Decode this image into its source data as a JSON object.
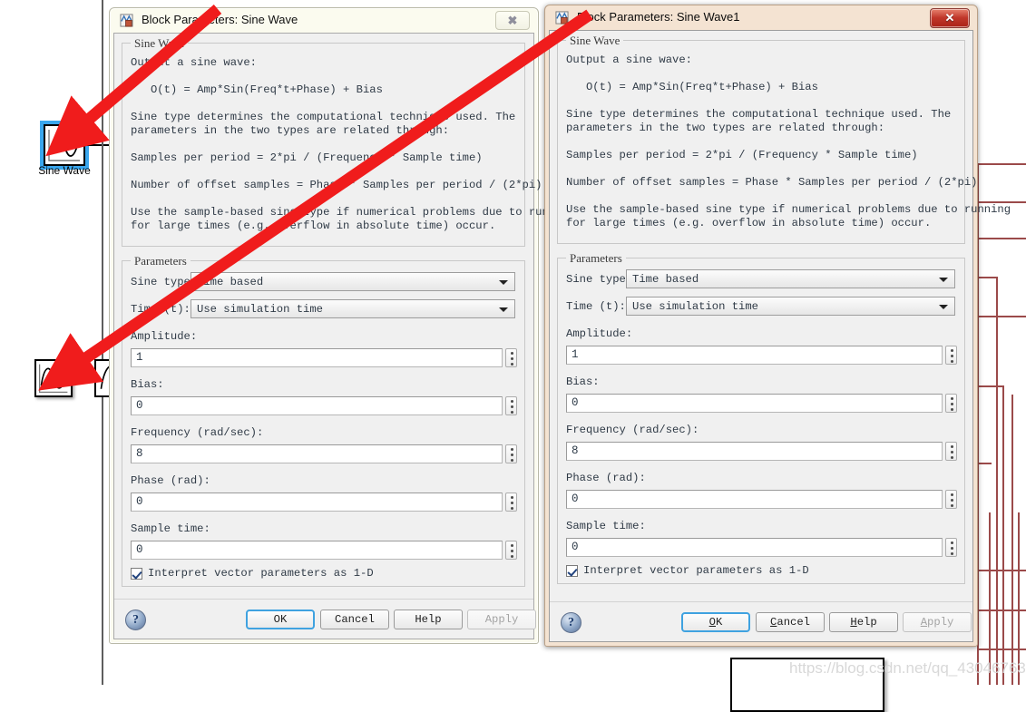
{
  "canvas": {
    "blocks": [
      {
        "name": "sine-wave-block-top",
        "label": "Sine Wave",
        "selected": true
      },
      {
        "name": "sine-wave-block-bottom",
        "label": "",
        "selected": false
      },
      {
        "name": "downstream-block",
        "label": "",
        "selected": false
      }
    ],
    "watermark": "https://blog.csdn.net/qq_43046763"
  },
  "dialogs": [
    {
      "id": "left",
      "active": false,
      "title": "Block Parameters: Sine Wave",
      "title_icon": "simulink-block-icon",
      "close_glyph": "✖",
      "description_group_title": "Sine Wave",
      "description_lines": [
        "Output a sine wave:",
        "",
        "   O(t) = Amp*Sin(Freq*t+Phase) + Bias",
        "",
        "Sine type determines the computational technique used. The",
        "parameters in the two types are related through:",
        "",
        "Samples per period = 2*pi / (Frequency * Sample time)",
        "",
        "Number of offset samples = Phase * Samples per period / (2*pi)",
        "",
        "Use the sample-based sine type if numerical problems due to running",
        "for large times (e.g. overflow in absolute time) occur."
      ],
      "parameters_group_title": "Parameters",
      "fields": [
        {
          "name": "sine-type",
          "label": "Sine type:",
          "type": "combo",
          "value": "Time based"
        },
        {
          "name": "time-t",
          "label": "Time (t):",
          "type": "combo",
          "value": "Use simulation time"
        },
        {
          "name": "amplitude",
          "label": "Amplitude:",
          "type": "edit",
          "value": "1"
        },
        {
          "name": "bias",
          "label": "Bias:",
          "type": "edit",
          "value": "0"
        },
        {
          "name": "frequency",
          "label": "Frequency (rad/sec):",
          "type": "edit",
          "value": "8"
        },
        {
          "name": "phase",
          "label": "Phase (rad):",
          "type": "edit",
          "value": "0"
        },
        {
          "name": "sample-time",
          "label": "Sample time:",
          "type": "edit",
          "value": "0"
        }
      ],
      "checkbox": {
        "label": "Interpret vector parameters as 1-D",
        "checked": true
      },
      "help_icon": "?",
      "buttons": [
        {
          "name": "ok-button",
          "label": "OK",
          "mnemonic": "",
          "default": true,
          "disabled": false
        },
        {
          "name": "cancel-button",
          "label": "Cancel",
          "mnemonic": "",
          "default": false,
          "disabled": false
        },
        {
          "name": "help-button",
          "label": "Help",
          "mnemonic": "",
          "default": false,
          "disabled": false
        },
        {
          "name": "apply-button",
          "label": "Apply",
          "mnemonic": "",
          "default": false,
          "disabled": true
        }
      ]
    },
    {
      "id": "right",
      "active": true,
      "title": "Block Parameters: Sine Wave1",
      "title_icon": "simulink-block-icon",
      "close_glyph": "✕",
      "description_group_title": "Sine Wave",
      "description_lines": [
        "Output a sine wave:",
        "",
        "   O(t) = Amp*Sin(Freq*t+Phase) + Bias",
        "",
        "Sine type determines the computational technique used. The",
        "parameters in the two types are related through:",
        "",
        "Samples per period = 2*pi / (Frequency * Sample time)",
        "",
        "Number of offset samples = Phase * Samples per period / (2*pi)",
        "",
        "Use the sample-based sine type if numerical problems due to running",
        "for large times (e.g. overflow in absolute time) occur."
      ],
      "parameters_group_title": "Parameters",
      "fields": [
        {
          "name": "sine-type",
          "label": "Sine type:",
          "type": "combo",
          "value": "Time based"
        },
        {
          "name": "time-t",
          "label": "Time (t):",
          "type": "combo",
          "value": "Use simulation time"
        },
        {
          "name": "amplitude",
          "label": "Amplitude:",
          "type": "edit",
          "value": "1"
        },
        {
          "name": "bias",
          "label": "Bias:",
          "type": "edit",
          "value": "0"
        },
        {
          "name": "frequency",
          "label": "Frequency (rad/sec):",
          "type": "edit",
          "value": "8"
        },
        {
          "name": "phase",
          "label": "Phase (rad):",
          "type": "edit",
          "value": "0"
        },
        {
          "name": "sample-time",
          "label": "Sample time:",
          "type": "edit",
          "value": "0"
        }
      ],
      "checkbox": {
        "label": "Interpret vector parameters as 1-D",
        "checked": true
      },
      "help_icon": "?",
      "buttons": [
        {
          "name": "ok-button",
          "label": "OK",
          "mnemonic": "O",
          "default": true,
          "disabled": false
        },
        {
          "name": "cancel-button",
          "label": "Cancel",
          "mnemonic": "C",
          "default": false,
          "disabled": false
        },
        {
          "name": "help-button",
          "label": "Help",
          "mnemonic": "H",
          "default": false,
          "disabled": false
        },
        {
          "name": "apply-button",
          "label": "Apply",
          "mnemonic": "A",
          "default": false,
          "disabled": true
        }
      ]
    }
  ],
  "annotations": {
    "arrows": [
      {
        "name": "red-arrow-to-sine-wave-top"
      },
      {
        "name": "red-arrow-to-sine-wave-bottom"
      }
    ],
    "color": "#f01c1c"
  }
}
